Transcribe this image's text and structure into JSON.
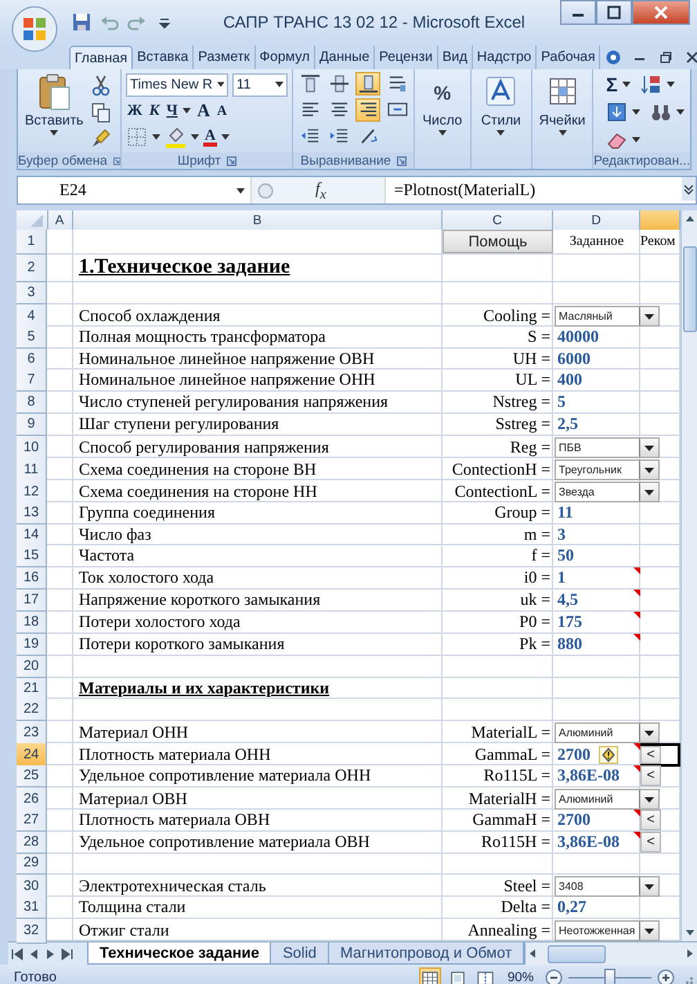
{
  "window": {
    "title": "САПР ТРАНС 13 02 12 - Microsoft Excel"
  },
  "ribbon_tabs": [
    {
      "label": "Главная",
      "selected": true
    },
    {
      "label": "Вставка",
      "selected": false
    },
    {
      "label": "Разметк",
      "selected": false
    },
    {
      "label": "Формул",
      "selected": false
    },
    {
      "label": "Данные",
      "selected": false
    },
    {
      "label": "Рецензи",
      "selected": false
    },
    {
      "label": "Вид",
      "selected": false
    },
    {
      "label": "Надстро",
      "selected": false
    },
    {
      "label": "Рабочая",
      "selected": false
    }
  ],
  "ribbon": {
    "clipboard": {
      "paste": "Вставить",
      "label": "Буфер обмена"
    },
    "font": {
      "name": "Times New R",
      "size": "11",
      "bold": "Ж",
      "italic": "К",
      "underline": "Ч",
      "grow": "A",
      "shrink": "A",
      "font_color_button": "A",
      "label": "Шрифт"
    },
    "alignment": {
      "label": "Выравнивание",
      "buttons": [
        {
          "kind": "top",
          "selected": false
        },
        {
          "kind": "middle",
          "selected": false
        },
        {
          "kind": "bottom",
          "selected": true
        },
        {
          "kind": "wrap",
          "selected": false
        },
        {
          "kind": "left",
          "selected": false
        },
        {
          "kind": "center",
          "selected": false
        },
        {
          "kind": "right",
          "selected": true
        },
        {
          "kind": "merge",
          "selected": false
        },
        {
          "kind": "outdent",
          "selected": false
        },
        {
          "kind": "indent",
          "selected": false
        },
        {
          "kind": "orientation",
          "selected": false
        }
      ]
    },
    "number": {
      "symbol": "%",
      "label": "Число"
    },
    "styles": {
      "label": "Стили"
    },
    "cells": {
      "label": "Ячейки"
    },
    "editing": {
      "sum": "Σ",
      "label": "Редактирован..."
    }
  },
  "formula_bar": {
    "cell": "E24",
    "function_label": "f$_{x}$",
    "formula": "=Plotnost(MaterialL)"
  },
  "columns": [
    {
      "label": "A",
      "selected": false
    },
    {
      "label": "B",
      "selected": false
    },
    {
      "label": "C",
      "selected": false
    },
    {
      "label": "D",
      "selected": false
    }
  ],
  "column_5": {
    "selected": true
  },
  "rows": [
    {
      "number": "1",
      "kind": "header",
      "selected": false,
      "help": "Помощь",
      "given": "Заданное",
      "column_5": "Реком"
    },
    {
      "number": "2",
      "kind": "title",
      "selected": false,
      "label": "1.Техническое задание"
    },
    {
      "number": "3",
      "kind": "blank",
      "selected": false
    },
    {
      "number": "4",
      "kind": "dropdown",
      "selected": false,
      "label": "Способ охлаждения",
      "name": "Cooling =",
      "value": "Масляный"
    },
    {
      "number": "5",
      "kind": "value",
      "selected": false,
      "label": "Полная мощность трансформатора",
      "name": "S =",
      "value": "40000",
      "comment": false,
      "warning": false
    },
    {
      "number": "6",
      "kind": "value",
      "selected": false,
      "label": "Номинальное линейное напряжение ОВН",
      "name": "UH =",
      "value": "6000",
      "comment": false,
      "warning": false
    },
    {
      "number": "7",
      "kind": "value",
      "selected": false,
      "label": "Номинальное линейное напряжение ОНН",
      "name": "UL =",
      "value": "400",
      "comment": false,
      "warning": false
    },
    {
      "number": "8",
      "kind": "value",
      "selected": false,
      "label": "Число ступеней регулирования напряжения",
      "name": "Nstreg =",
      "value": "5",
      "comment": false,
      "warning": false
    },
    {
      "number": "9",
      "kind": "value",
      "selected": false,
      "label": "Шаг ступени регулирования",
      "name": "Sstreg =",
      "value": "2,5",
      "comment": false,
      "warning": false
    },
    {
      "number": "10",
      "kind": "dropdown",
      "selected": false,
      "label": "Способ регулирования напряжения",
      "name": "Reg =",
      "value": "ПБВ"
    },
    {
      "number": "11",
      "kind": "dropdown",
      "selected": false,
      "label": "Схема соединения на стороне ВН",
      "name": "ContectionH =",
      "value": "Треугольник"
    },
    {
      "number": "12",
      "kind": "dropdown",
      "selected": false,
      "label": "Схема соединения на стороне НН",
      "name": "ContectionL =",
      "value": "Звезда"
    },
    {
      "number": "13",
      "kind": "value",
      "selected": false,
      "label": "Группа соединения",
      "name": "Group =",
      "value": "11",
      "comment": false,
      "warning": false
    },
    {
      "number": "14",
      "kind": "value",
      "selected": false,
      "label": "Число фаз",
      "name": "m =",
      "value": "3",
      "comment": false,
      "warning": false
    },
    {
      "number": "15",
      "kind": "value",
      "selected": false,
      "label": "Частота",
      "name": "f =",
      "value": "50",
      "comment": false,
      "warning": false
    },
    {
      "number": "16",
      "kind": "value",
      "selected": false,
      "label": "Ток холостого хода",
      "name": "i0 =",
      "value": "1",
      "comment": true,
      "warning": false
    },
    {
      "number": "17",
      "kind": "value",
      "selected": false,
      "label": "Напряжение короткого замыкания",
      "name": "uk =",
      "value": "4,5",
      "comment": true,
      "warning": false
    },
    {
      "number": "18",
      "kind": "value",
      "selected": false,
      "label": "Потери холостого хода",
      "name": "P0 =",
      "value": "175",
      "comment": true,
      "warning": false
    },
    {
      "number": "19",
      "kind": "value",
      "selected": false,
      "label": "Потери короткого замыкания",
      "name": "Pk =",
      "value": "880",
      "comment": true,
      "warning": false
    },
    {
      "number": "20",
      "kind": "blank",
      "selected": false
    },
    {
      "number": "21",
      "kind": "heading",
      "selected": false,
      "label": "Материалы и их характеристики"
    },
    {
      "number": "22",
      "kind": "blank",
      "selected": false
    },
    {
      "number": "23",
      "kind": "dropdown",
      "selected": false,
      "label": "Материал ОНН",
      "name": "MaterialL =",
      "value": "Алюминий"
    },
    {
      "number": "24",
      "kind": "value",
      "selected": true,
      "label": "Плотность материала ОНН",
      "name": "GammaL =",
      "value": "2700",
      "comment": true,
      "warning": true,
      "back_button": "<"
    },
    {
      "number": "25",
      "kind": "value",
      "selected": false,
      "label": "Удельное сопротивление материала ОНН",
      "name": "Ro115L =",
      "value": "3,86E-08",
      "comment": true,
      "warning": false,
      "back_button": "<"
    },
    {
      "number": "26",
      "kind": "dropdown",
      "selected": false,
      "label": "Материал ОВН",
      "name": "MaterialH =",
      "value": "Алюминий"
    },
    {
      "number": "27",
      "kind": "value",
      "selected": false,
      "label": "Плотность материала ОВН",
      "name": "GammaH =",
      "value": "2700",
      "comment": true,
      "warning": false,
      "back_button": "<"
    },
    {
      "number": "28",
      "kind": "value",
      "selected": false,
      "label": "Удельное сопротивление материала ОВН",
      "name": "Ro115H =",
      "value": "3,86E-08",
      "comment": true,
      "warning": false,
      "back_button": "<"
    },
    {
      "number": "29",
      "kind": "blank",
      "selected": false
    },
    {
      "number": "30",
      "kind": "dropdown",
      "selected": false,
      "label": "Электротехническая сталь",
      "name": "Steel =",
      "value": "3408"
    },
    {
      "number": "31",
      "kind": "value",
      "selected": false,
      "label": "Толщина стали",
      "name": "Delta =",
      "value": "0,27",
      "comment": false,
      "warning": false
    },
    {
      "number": "32",
      "kind": "dropdown",
      "selected": false,
      "label": "Отжиг стали",
      "name": "Annealing =",
      "value": "Неотожженная"
    }
  ],
  "sheet_tabs": [
    {
      "label": "Техническое задание",
      "selected": true
    },
    {
      "label": "Solid",
      "selected": false
    },
    {
      "label": "Магнитопровод и Обмот",
      "selected": false
    }
  ],
  "status_bar": {
    "text": "Готово",
    "views": [
      {
        "kind": "normal",
        "selected": true
      },
      {
        "kind": "layout",
        "selected": false
      },
      {
        "kind": "pagebreak",
        "selected": false
      }
    ],
    "zoom": "90%",
    "zoom_slider": {
      "level": 0.5
    }
  }
}
